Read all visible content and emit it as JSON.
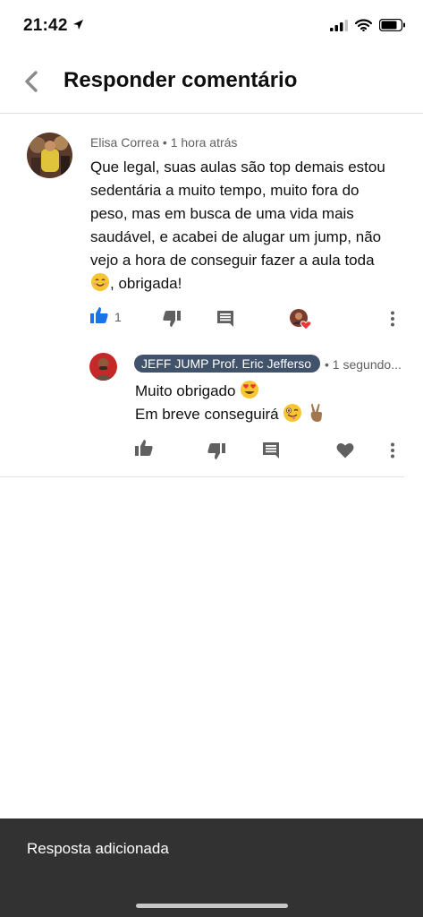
{
  "status_bar": {
    "time": "21:42"
  },
  "header": {
    "title": "Responder comentário"
  },
  "comment": {
    "author": "Elisa Correa",
    "time": "1 hora atrás",
    "lines": [
      "Que legal, suas aulas são top demais estou",
      "sedentária a muito tempo, muito fora do",
      "peso, mas em busca de uma vida mais",
      "saudável, e acabei de alugar um jump, não",
      "vejo a hora de conseguir fazer a aula toda"
    ],
    "last_line_emoji": "smiling-face",
    "last_line_text": ", obrigada!",
    "like_count": "1",
    "like_active_color": "#1a73e8"
  },
  "reply": {
    "author": "JEFF JUMP Prof. Eric Jefferso",
    "time": "1 segundo...",
    "line1": "Muito obrigado",
    "line1_emoji": "heart-eyes-face",
    "line2": "Em breve conseguirá",
    "line2_emoji": "winking-tongue-face",
    "line2_emoji_2": "victory-hand",
    "author_chip_color": "#41526b"
  },
  "snackbar": {
    "text": "Resposta adicionada"
  }
}
